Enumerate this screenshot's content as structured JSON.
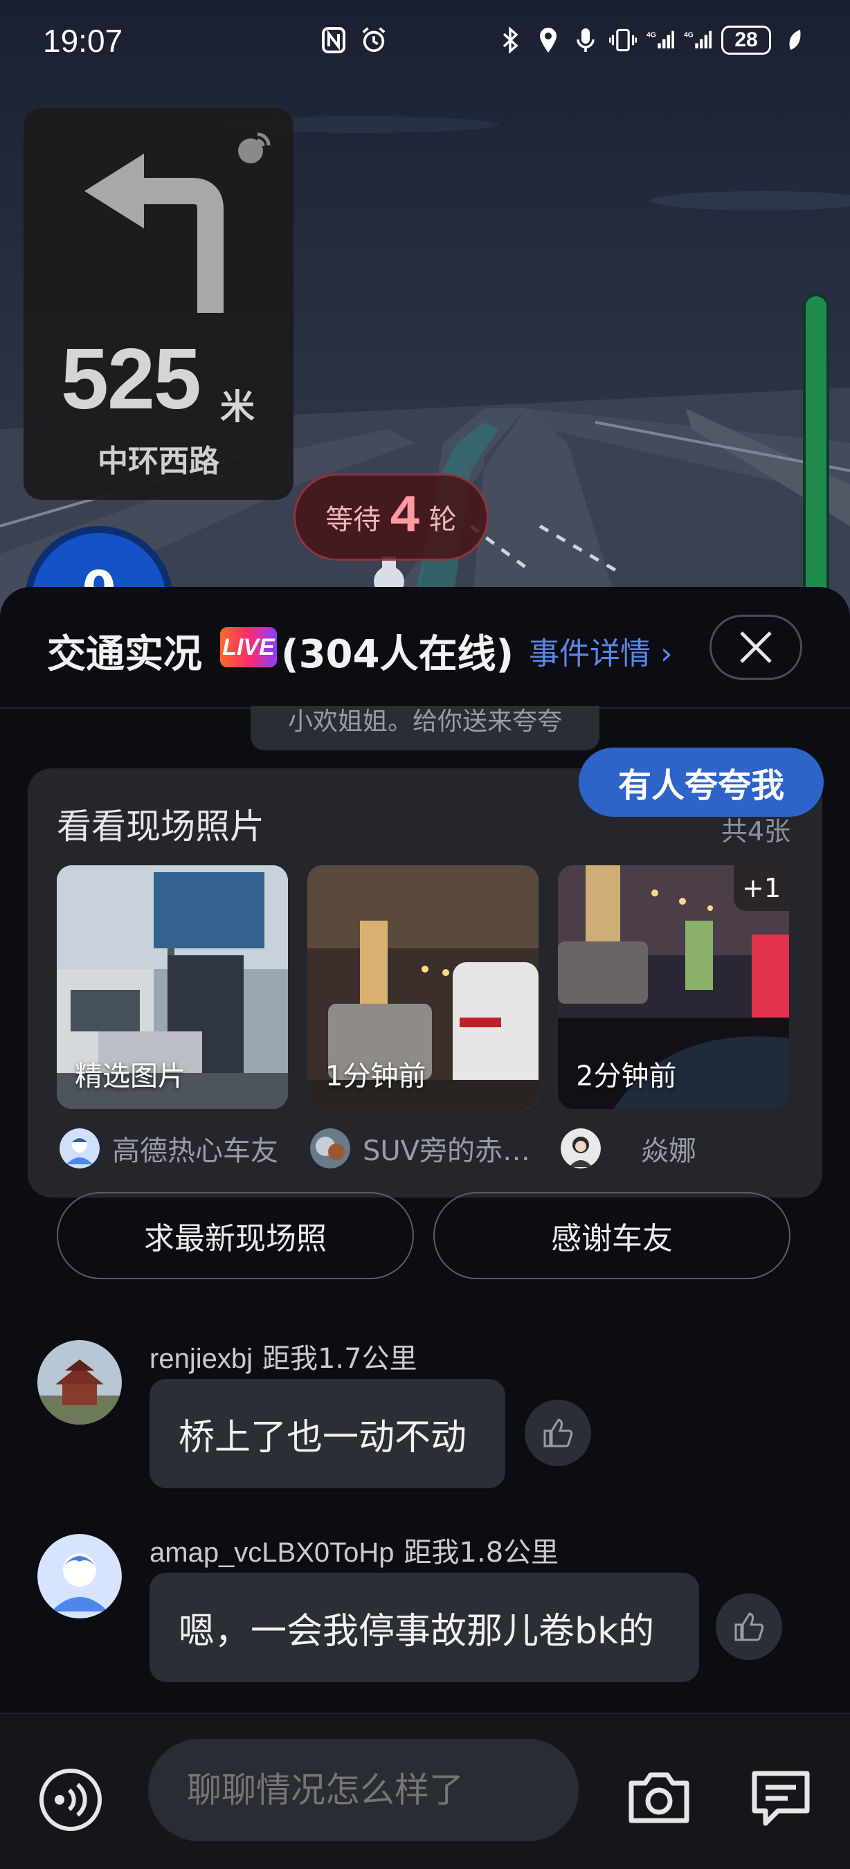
{
  "status_bar": {
    "time": "19:07",
    "battery": "28",
    "left_icons": [
      "nfc-icon",
      "alarm-icon"
    ],
    "right_icons": [
      "bluetooth-icon",
      "location-icon",
      "mic-icon",
      "vibrate-icon",
      "signal-4g-icon",
      "signal-4g-icon"
    ]
  },
  "navigation": {
    "turn_direction": "left",
    "distance_value": "525",
    "distance_unit": "米",
    "road_name": "中环西路",
    "wait_label_before": "等待",
    "wait_rounds": "4",
    "wait_label_after": "轮",
    "speed_partial": "0"
  },
  "sheet": {
    "title": "交通实况",
    "live_badge": "LIVE",
    "online_text": "(304人在线)",
    "detail_link": "事件详情",
    "reward_note": "小欢姐姐。给你送来夸夸",
    "praise_button": "有人夸夸我"
  },
  "photos": {
    "title": "看看现场照片",
    "count": "共4张",
    "items": [
      {
        "caption": "精选图片",
        "uploader": "高德热心车友"
      },
      {
        "caption": "1分钟前",
        "uploader": "SUV旁的赤…"
      },
      {
        "caption": "2分钟前",
        "uploader": "焱娜",
        "extra": "+1"
      }
    ],
    "request_button": "求最新现场照",
    "thanks_button": "感谢车友"
  },
  "comments": [
    {
      "user": "renjiexbj",
      "distance": "距我1.7公里",
      "text": "桥上了也一动不动"
    },
    {
      "user": "amap_vcLBX0ToHp",
      "distance": "距我1.8公里",
      "text": "嗯，一会我停事故那儿卷bk的"
    }
  ],
  "input": {
    "placeholder": "聊聊情况怎么样了"
  },
  "colors": {
    "accent_blue": "#2e63c9",
    "link_blue": "#5b86e6",
    "route_green": "#1e8a4e"
  }
}
